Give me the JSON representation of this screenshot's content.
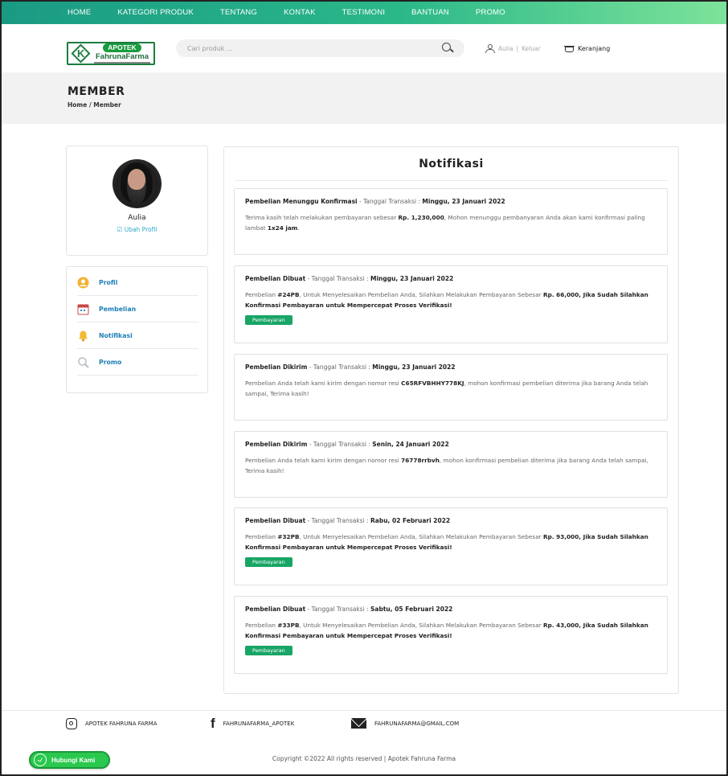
{
  "nav": {
    "items": [
      "HOME",
      "KATEGORI PRODUK",
      "TENTANG",
      "KONTAK",
      "TESTIMONI",
      "BANTUAN",
      "PROMO"
    ]
  },
  "header": {
    "logo": {
      "top": "APOTEK",
      "name": "FahrunaFarma"
    },
    "search_placeholder": "Cari produk ...",
    "user_name": "Aulia",
    "user_sep": "|",
    "logout_label": "Keluar",
    "cart_label": "Keranjang"
  },
  "banner": {
    "title": "MEMBER",
    "breadcrumb": "Home / Member"
  },
  "profile": {
    "name": "Aulia",
    "edit_label": "Ubah Profil"
  },
  "menu": [
    {
      "label": "Profil",
      "icon": "user-circle-icon"
    },
    {
      "label": "Pembelian",
      "icon": "calendar-icon"
    },
    {
      "label": "Notifikasi",
      "icon": "bell-icon"
    },
    {
      "label": "Promo",
      "icon": "promo-icon"
    }
  ],
  "panel": {
    "title": "Notifikasi"
  },
  "notifications": [
    {
      "status": "Pembelian Menunggu Konfirmasi",
      "date_prefix": "- Tanggal Transaksi :",
      "date": "Minggu, 23 Januari 2022",
      "body_1": "Terima kasih telah melakukan pembayaran sebesar ",
      "body_b1": "Rp. 1,230,000",
      "body_2": ", Mohon menunggu pembanyaran Anda akan kami konfirmasi paling lambat ",
      "body_b2": "1x24 jam",
      "body_3": "."
    },
    {
      "status": "Pembelian Dibuat",
      "date_prefix": "- Tanggal Transaksi :",
      "date": "Minggu, 23 Januari 2022",
      "body_1": "Pembelian ",
      "body_b1": "#24PB",
      "body_2": ", Untuk Menyelesaikan Pembelian Anda, Silahkan Melakukan Pembayaran Sebesar ",
      "body_b2": "Rp. 66,000, Jika Sudah Silahkan Konfirmasi Pembayaran untuk Mempercepat Proses Verifikasi!",
      "body_3": "",
      "button": "Pembayaran"
    },
    {
      "status": "Pembelian Dikirim",
      "date_prefix": "- Tanggal Transaksi :",
      "date": "Minggu, 23 Januari 2022",
      "body_1": "Pembelian Anda telah kami kirim dengan nomor resi ",
      "body_b1": "C65RFVBHHY778KJ",
      "body_2": ", mohon konfirmasi pembelian diterima jika barang Anda telah sampai, Terima kasih!",
      "body_b2": "",
      "body_3": ""
    },
    {
      "status": "Pembelian Dikirim",
      "date_prefix": "- Tanggal Transaksi :",
      "date": "Senin, 24 Januari 2022",
      "body_1": "Pembelian Anda telah kami kirim dengan nomor resi ",
      "body_b1": "76778rrbvh",
      "body_2": ", mohon konfirmasi pembelian diterima jika barang Anda telah sampai, Terima kasih!",
      "body_b2": "",
      "body_3": ""
    },
    {
      "status": "Pembelian Dibuat",
      "date_prefix": "- Tanggal Transaksi :",
      "date": "Rabu, 02 Februari 2022",
      "body_1": "Pembelian ",
      "body_b1": "#32PB",
      "body_2": ", Untuk Menyelesaikan Pembelian Anda, Silahkan Melakukan Pembayaran Sebesar ",
      "body_b2": "Rp. 93,000, Jika Sudah Silahkan Konfirmasi Pembayaran untuk Mempercepat Proses Verifikasi!",
      "body_3": "",
      "button": "Pembayaran"
    },
    {
      "status": "Pembelian Dibuat",
      "date_prefix": "- Tanggal Transaksi :",
      "date": "Sabtu, 05 Februari 2022",
      "body_1": "Pembelian ",
      "body_b1": "#33PB",
      "body_2": ", Untuk Menyelesaikan Pembelian Anda, Silahkan Melakukan Pembayaran Sebesar ",
      "body_b2": "Rp. 43,000, Jika Sudah Silahkan Konfirmasi Pembayaran untuk Mempercepat Proses Verifikasi!",
      "body_3": "",
      "button": "Pembayaran"
    }
  ],
  "footer": {
    "instagram": "APOTEK FAHRUNA FARMA",
    "facebook": "FAHRUNAFARMA_APOTEK",
    "email": "FAHRUNAFARMA@GMAIL.COM",
    "copyright": "Copyright ©2022 All rights reserved | Apotek Fahruna Farma"
  },
  "whatsapp": {
    "label": "Hubungi Kami"
  },
  "colors": {
    "primary": "#1a9a84",
    "accent": "#18a566",
    "link": "#1e7fb8"
  }
}
